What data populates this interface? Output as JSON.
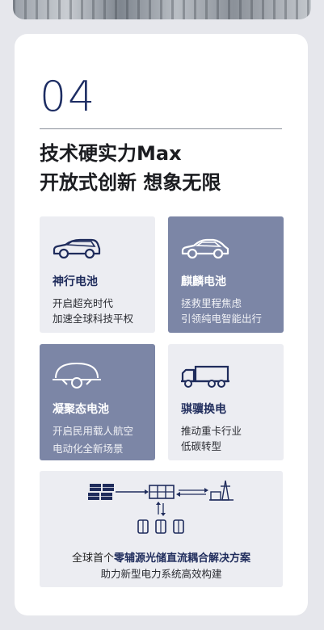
{
  "section": {
    "number": "04",
    "headline_line1": "技术硬实力Max",
    "headline_line2": "开放式创新 想象无限"
  },
  "tiles": [
    {
      "title": "神行电池",
      "line1": "开启超充时代",
      "line2": "加速全球科技平权",
      "icon": "car-wagon-icon"
    },
    {
      "title": "麒麟电池",
      "line1": "拯救里程焦虑",
      "line2": "引领纯电智能出行",
      "icon": "car-sedan-icon"
    },
    {
      "title": "凝聚态电池",
      "line1": "开启民用载人航空",
      "line2": "电动化全新场景",
      "icon": "aircraft-icon"
    },
    {
      "title": "骐骥换电",
      "line1": "推动重卡行业",
      "line2": "低碳转型",
      "icon": "truck-icon"
    }
  ],
  "solution": {
    "prefix": "全球首个",
    "highlight": "零辅源光储直流耦合解决方案",
    "subtitle": "助力新型电力系统高效构建",
    "icons": [
      "solar-panel-icon",
      "battery-storage-icon",
      "power-tower-icon",
      "load-icon"
    ]
  },
  "colors": {
    "accent_navy": "#1d2d63",
    "tile_dark": "#7c86a6",
    "tile_light": "#ecedf2"
  }
}
